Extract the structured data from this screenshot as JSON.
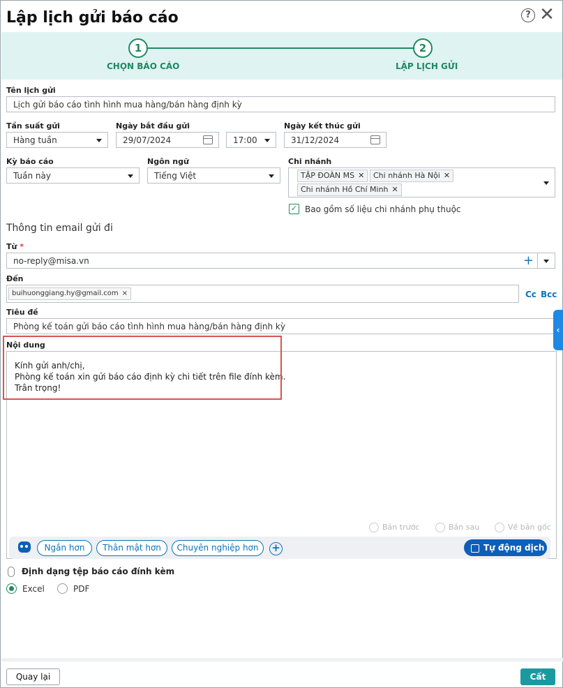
{
  "dialog": {
    "title": "Lập lịch gửi báo cáo"
  },
  "steps": [
    {
      "num": "1",
      "label": "CHỌN BÁO CÁO"
    },
    {
      "num": "2",
      "label": "LẬP LỊCH GỬI"
    }
  ],
  "schedule": {
    "name_label": "Tên lịch gửi",
    "name_value": "Lịch gửi báo cáo tình hình mua hàng/bán hàng định kỳ",
    "freq_label": "Tần suất gửi",
    "freq_value": "Hàng tuần",
    "start_label": "Ngày bắt đầu gửi",
    "start_value": "29/07/2024",
    "time_value": "17:00",
    "end_label": "Ngày kết thúc gửi",
    "end_value": "31/12/2024",
    "period_label": "Kỳ báo cáo",
    "period_value": "Tuần này",
    "lang_label": "Ngôn ngữ",
    "lang_value": "Tiếng Việt",
    "branch_label": "Chi nhánh",
    "branches": [
      "TẬP ĐOÀN MS",
      "Chi nhánh Hà Nội",
      "Chi nhánh Hồ Chí Minh"
    ],
    "include_sub": "Bao gồm số liệu chi nhánh phụ thuộc"
  },
  "email": {
    "section": "Thông tin email gửi đi",
    "from_label": "Từ",
    "from_req": "*",
    "from_value": "no-reply@misa.vn",
    "to_label": "Đến",
    "to_tag": "buihuonggiang.hy@gmail.com",
    "cc": "Cc",
    "bcc": "Bcc",
    "subject_label": "Tiêu đề",
    "subject_value": "Phòng kế toán gửi báo cáo tình hình mua hàng/bán hàng định kỳ",
    "content_label": "Nội dung",
    "content_lines": [
      "Kính gửi anh/chị,",
      "Phòng kế toán xin gửi báo cáo định kỳ chi tiết trên file đính kèm.",
      "Trân trọng!"
    ]
  },
  "history": {
    "prev": "Bản trước",
    "next": "Bản sau",
    "orig": "Về bản gốc"
  },
  "ai": {
    "pills": [
      "Ngắn hơn",
      "Thân mật hơn",
      "Chuyên nghiệp hơn"
    ],
    "translate": "Tự động dịch"
  },
  "attach": {
    "label": "Định dạng tệp báo cáo đính kèm",
    "options": [
      "Excel",
      "PDF"
    ]
  },
  "footer": {
    "back": "Quay lại",
    "save": "Cất"
  },
  "colors": {
    "accent": "#1f8a5e",
    "link": "#0d74b8",
    "primary": "#1a9aa0"
  }
}
